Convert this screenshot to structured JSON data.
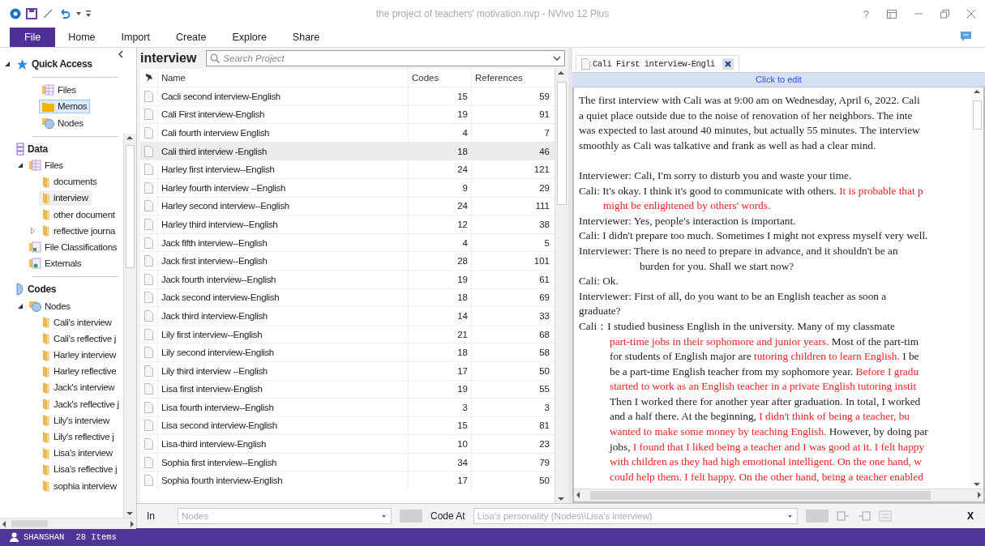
{
  "window": {
    "title": "the project of teachers' motivation.nvp - NVivo 12 Plus",
    "help": "?"
  },
  "ribbon": {
    "tabs": [
      {
        "label": "File",
        "selected": true
      },
      {
        "label": "Home",
        "selected": false
      },
      {
        "label": "Import",
        "selected": false
      },
      {
        "label": "Create",
        "selected": false
      },
      {
        "label": "Explore",
        "selected": false
      },
      {
        "label": "Share",
        "selected": false
      }
    ]
  },
  "sidebar": {
    "groups": [
      {
        "kind": "quick",
        "label": "Quick Access",
        "expanded": true,
        "children": [
          {
            "kind": "files",
            "label": "Files",
            "selected": false,
            "open": false
          },
          {
            "kind": "memos",
            "label": "Memos",
            "selected": true,
            "open": false
          },
          {
            "kind": "nodes",
            "label": "Nodes",
            "selected": false,
            "open": false
          }
        ]
      },
      {
        "kind": "data",
        "label": "Data",
        "children": [
          {
            "kind": "files",
            "label": "Files",
            "expanded": true,
            "selected": false,
            "open": false,
            "children": [
              {
                "kind": "folder",
                "label": "documents",
                "selected": false,
                "open": false
              },
              {
                "kind": "folder",
                "label": "interview",
                "selected": false,
                "open": true
              },
              {
                "kind": "folder",
                "label": "other document",
                "selected": false,
                "open": false
              },
              {
                "kind": "folder",
                "label": "reflective journa",
                "expanded": false,
                "selected": false,
                "open": false
              }
            ]
          },
          {
            "kind": "classifications",
            "label": "File Classifications",
            "selected": false,
            "open": false
          },
          {
            "kind": "externals",
            "label": "Externals",
            "selected": false,
            "open": false
          }
        ]
      },
      {
        "kind": "codes",
        "label": "Codes",
        "children": [
          {
            "kind": "nodes",
            "label": "Nodes",
            "expanded": true,
            "selected": false,
            "open": false,
            "children": [
              {
                "kind": "folder",
                "label": "Cali's interview",
                "selected": false,
                "open": false
              },
              {
                "kind": "folder",
                "label": "Cali's reflective j",
                "selected": false,
                "open": false
              },
              {
                "kind": "folder",
                "label": "Harley interview",
                "selected": false,
                "open": false
              },
              {
                "kind": "folder",
                "label": "Harley reflective",
                "selected": false,
                "open": false
              },
              {
                "kind": "folder",
                "label": "Jack's interview",
                "selected": false,
                "open": false
              },
              {
                "kind": "folder",
                "label": "Jack's reflective j",
                "selected": false,
                "open": false
              },
              {
                "kind": "folder",
                "label": "Lily's interview",
                "selected": false,
                "open": false
              },
              {
                "kind": "folder",
                "label": "Lily's reflective j",
                "selected": false,
                "open": false
              },
              {
                "kind": "folder",
                "label": "Lisa's interview",
                "selected": false,
                "open": false
              },
              {
                "kind": "folder",
                "label": "Lisa's reflective j",
                "selected": false,
                "open": false
              },
              {
                "kind": "folder",
                "label": "sophia interview",
                "selected": false,
                "open": false
              }
            ]
          }
        ]
      }
    ]
  },
  "list": {
    "title": "interview",
    "search": {
      "placeholder": "Search Project"
    },
    "columns": [
      "Name",
      "Codes",
      "References"
    ],
    "rows": [
      {
        "name": "Cacli second interview-English",
        "codes": "15",
        "references": "59",
        "selected": false
      },
      {
        "name": "Cali First interview-English",
        "codes": "19",
        "references": "91",
        "selected": false
      },
      {
        "name": "Cali fourth interview English",
        "codes": "4",
        "references": "7",
        "selected": false
      },
      {
        "name": "Cali third interview -English",
        "codes": "18",
        "references": "46",
        "selected": true
      },
      {
        "name": "Harley first interview--English",
        "codes": "24",
        "references": "121",
        "selected": false
      },
      {
        "name": "Harley fourth interview --English",
        "codes": "9",
        "references": "29",
        "selected": false
      },
      {
        "name": "Harley second interview--English",
        "codes": "24",
        "references": "111",
        "selected": false
      },
      {
        "name": "Harley third interview--English",
        "codes": "12",
        "references": "38",
        "selected": false
      },
      {
        "name": "Jack fifth interview--English",
        "codes": "4",
        "references": "5",
        "selected": false
      },
      {
        "name": "Jack first interview--English",
        "codes": "28",
        "references": "101",
        "selected": false
      },
      {
        "name": "Jack fourth interview--English",
        "codes": "19",
        "references": "61",
        "selected": false
      },
      {
        "name": "Jack second interview-English",
        "codes": "18",
        "references": "69",
        "selected": false
      },
      {
        "name": "Jack third interview-English",
        "codes": "14",
        "references": "33",
        "selected": false
      },
      {
        "name": "Lily first interview--English",
        "codes": "21",
        "references": "68",
        "selected": false
      },
      {
        "name": "Lily second interview-English",
        "codes": "18",
        "references": "58",
        "selected": false
      },
      {
        "name": "Lily third interview --English",
        "codes": "17",
        "references": "50",
        "selected": false
      },
      {
        "name": "Lisa first interview-English",
        "codes": "19",
        "references": "55",
        "selected": false
      },
      {
        "name": "Lisa fourth interview--English",
        "codes": "3",
        "references": "3",
        "selected": false
      },
      {
        "name": "Lisa second interview-English",
        "codes": "15",
        "references": "81",
        "selected": false
      },
      {
        "name": "Lisa-third interview-English",
        "codes": "10",
        "references": "23",
        "selected": false
      },
      {
        "name": "Sophia first interview--English",
        "codes": "34",
        "references": "79",
        "selected": false
      },
      {
        "name": "Sophia fourth interview-English",
        "codes": "17",
        "references": "50",
        "selected": false
      }
    ]
  },
  "document": {
    "tab": "Cali First interview-Engli",
    "edit_bar": "Click to edit",
    "paragraphs": [
      {
        "lines": [
          {
            "kind": "plain",
            "segments": [
              {
                "text": "The first interview with Cali was at 9:00 am on Wednesday, April 6, 2022. Cali",
                "coded": false
              }
            ]
          },
          {
            "kind": "plain",
            "segments": [
              {
                "text": "a quiet place outside due to the noise of renovation of her neighbors. The inte",
                "coded": false
              }
            ]
          },
          {
            "kind": "plain",
            "segments": [
              {
                "text": "was expected to last around 40 minutes, but actually 55 minutes. The interview",
                "coded": false
              }
            ]
          },
          {
            "kind": "plain",
            "segments": [
              {
                "text": "smoothly as Cali was talkative and frank as well as had a clear mind.",
                "coded": false
              }
            ]
          }
        ]
      },
      {
        "lines": [
          {
            "kind": "plain",
            "segments": [
              {
                "text": "Interviewer: Cali, I'm sorry to disturb you and waste your time.",
                "coded": false
              }
            ]
          },
          {
            "kind": "plain",
            "segments": [
              {
                "text": "Cali: It's okay. I think it's good to communicate with others. ",
                "coded": false
              },
              {
                "text": "It is probable that p",
                "coded": true
              }
            ]
          },
          {
            "kind": "hang",
            "segments": [
              {
                "text": "might be enlightened by others' words.",
                "coded": true
              }
            ]
          },
          {
            "kind": "plain",
            "segments": [
              {
                "text": "Interviewer: Yes, people's interaction is important.",
                "coded": false
              }
            ]
          },
          {
            "kind": "plain",
            "segments": [
              {
                "text": "Cali: I didn't prepare too much. Sometimes I might not express myself very well.",
                "coded": false
              }
            ]
          },
          {
            "kind": "plain",
            "segments": [
              {
                "text": "Interviewer: There is no need to prepare in advance, and it shouldn't be an",
                "coded": false
              }
            ]
          },
          {
            "kind": "deep",
            "segments": [
              {
                "text": "burden for you. Shall we start now?",
                "coded": false
              }
            ]
          },
          {
            "kind": "plain",
            "segments": [
              {
                "text": "Cali: Ok.",
                "coded": false
              }
            ]
          },
          {
            "kind": "plain",
            "segments": [
              {
                "text": "Interviewer: First of all, do you want to be an English teacher as soon a",
                "coded": false
              }
            ]
          },
          {
            "kind": "plain",
            "segments": [
              {
                "text": "graduate?",
                "coded": false
              }
            ]
          },
          {
            "kind": "plain",
            "segments": [
              {
                "text": "Cali：I studied business English in the university. Many of my classmate",
                "coded": false
              }
            ]
          },
          {
            "kind": "wide",
            "segments": [
              {
                "text": "part-time jobs in their sophomore and junior years.",
                "coded": true
              },
              {
                "text": " Most of the part-tim",
                "coded": false
              }
            ]
          },
          {
            "kind": "wide",
            "segments": [
              {
                "text": "for students of English major are ",
                "coded": false
              },
              {
                "text": "tutoring children to learn English.",
                "coded": true
              },
              {
                "text": " I be",
                "coded": false
              }
            ]
          },
          {
            "kind": "wide",
            "segments": [
              {
                "text": "be a part-time English teacher from my sophomore year. ",
                "coded": false
              },
              {
                "text": "Before I gradu",
                "coded": true
              }
            ]
          },
          {
            "kind": "wide",
            "segments": [
              {
                "text": "started to work as an English teacher in a private English tutoring instit",
                "coded": true
              }
            ]
          },
          {
            "kind": "wide",
            "segments": [
              {
                "text": "Then I worked there for another year after graduation. In total, I worked",
                "coded": false
              }
            ]
          },
          {
            "kind": "wide",
            "segments": [
              {
                "text": "and a half there. At the beginning, ",
                "coded": false
              },
              {
                "text": "I didn't think of being a teacher, bu",
                "coded": true
              }
            ]
          },
          {
            "kind": "wide",
            "segments": [
              {
                "text": "wanted to make some money by teaching English.",
                "coded": true
              },
              {
                "text": " However, by doing par",
                "coded": false
              }
            ]
          },
          {
            "kind": "wide",
            "segments": [
              {
                "text": "jobs, ",
                "coded": false
              },
              {
                "text": "I found that I liked being a teacher and I was good at it. I felt happy",
                "coded": true
              }
            ]
          },
          {
            "kind": "wide",
            "segments": [
              {
                "text": "with children as they had high emotional intelligent. On the one hand, w",
                "coded": true
              }
            ]
          },
          {
            "kind": "wide",
            "segments": [
              {
                "text": "could help them. I felt happy. On the other hand, being a teacher enabled",
                "coded": true
              }
            ]
          }
        ]
      }
    ]
  },
  "code_bar": {
    "in_label": "In",
    "in_field": {
      "value": "Nodes",
      "disabled": true
    },
    "code_at_label": "Code At",
    "code_at_field": {
      "value": "Lisa's personality (Nodes\\\\Lisa's interview)",
      "disabled": true
    },
    "close": "X"
  },
  "status_bar": {
    "user": "SHANSHAN",
    "items": "28 Items"
  }
}
